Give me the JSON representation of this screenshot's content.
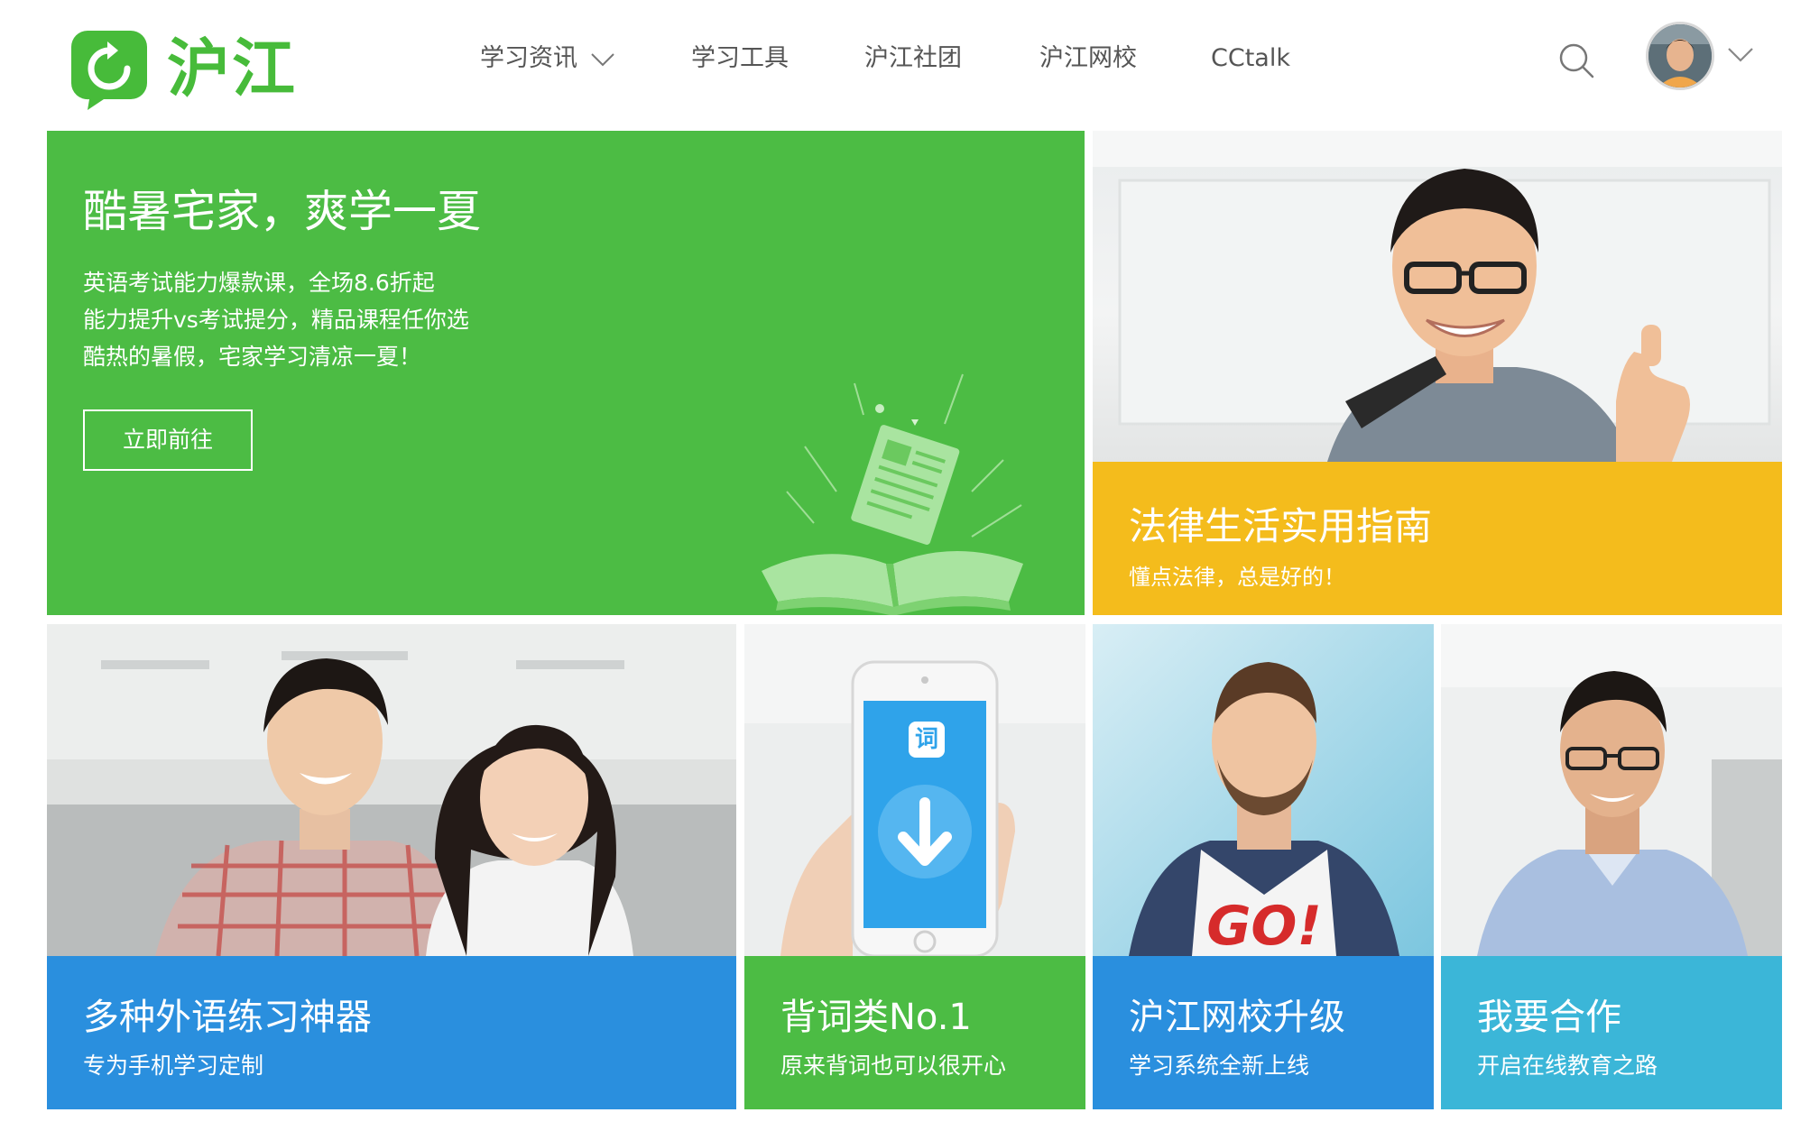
{
  "brand": {
    "name": "沪江",
    "color": "#47bb3a"
  },
  "nav": {
    "items": [
      {
        "label": "学习资讯",
        "has_dropdown": true
      },
      {
        "label": "学习工具",
        "has_dropdown": false
      },
      {
        "label": "沪江社团",
        "has_dropdown": false
      },
      {
        "label": "沪江网校",
        "has_dropdown": false
      },
      {
        "label": "CCtalk",
        "has_dropdown": false
      }
    ]
  },
  "header_icons": {
    "search": "search-icon",
    "user_menu": "chevron-down-icon"
  },
  "hero": {
    "title": "酷暑宅家，爽学一夏",
    "lines": [
      "英语考试能力爆款课，全场8.6折起",
      "能力提升vs考试提分，精品课程任你选",
      "酷热的暑假，宅家学习清凉一夏！"
    ],
    "button": "立即前往",
    "color": "#4cbc44"
  },
  "law": {
    "title": "法律生活实用指南",
    "subtitle": "懂点法律，总是好的！",
    "color": "#f4bc1c"
  },
  "tiles": [
    {
      "title": "多种外语练习神器",
      "subtitle": "专为手机学习定制",
      "color": "#2a8fde"
    },
    {
      "title": "背词类No.1",
      "subtitle": "原来背词也可以很开心",
      "color": "#4cbc44",
      "app_icon_text": "词"
    },
    {
      "title": "沪江网校升级",
      "subtitle": "学习系统全新上线",
      "color": "#2a8fde",
      "shirt_text": "GO!"
    },
    {
      "title": "我要合作",
      "subtitle": "开启在线教育之路",
      "color": "#3bb6d8"
    }
  ]
}
